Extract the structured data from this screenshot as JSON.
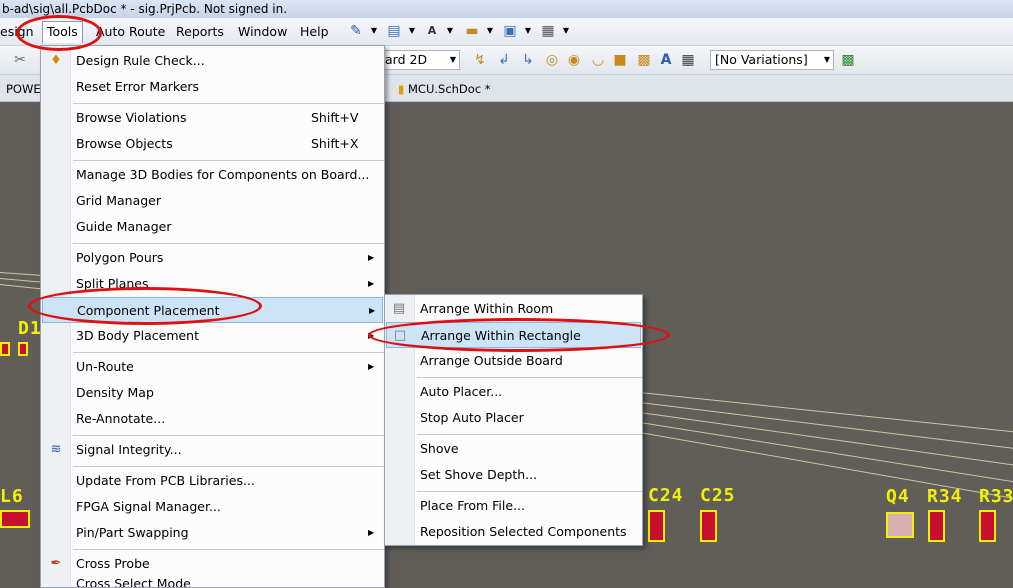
{
  "window": {
    "title": "b-ad\\sig\\all.PcbDoc * - sig.PrjPcb. Not signed in."
  },
  "menubar": {
    "items": [
      {
        "label": "esign"
      },
      {
        "label": "Tools"
      },
      {
        "label": "Auto Route"
      },
      {
        "label": "Reports"
      },
      {
        "label": "Window"
      },
      {
        "label": "Help"
      }
    ]
  },
  "toolbar": {
    "view_combo": "ard 2D",
    "variations_combo": "[No Variations]"
  },
  "tabs": {
    "left_tab": "POWE",
    "right_tab": "MCU.SchDoc *"
  },
  "tools_menu": {
    "items": [
      {
        "label": "Design Rule Check...",
        "shortcut": "",
        "icon": "drc-icon"
      },
      {
        "label": "Reset Error Markers",
        "shortcut": ""
      },
      {
        "label": "Browse Violations",
        "shortcut": "Shift+V"
      },
      {
        "label": "Browse Objects",
        "shortcut": "Shift+X"
      },
      {
        "label": "Manage 3D Bodies for Components on Board...",
        "shortcut": ""
      },
      {
        "label": "Grid Manager",
        "shortcut": ""
      },
      {
        "label": "Guide Manager",
        "shortcut": ""
      },
      {
        "label": "Polygon Pours",
        "shortcut": ""
      },
      {
        "label": "Split Planes",
        "shortcut": ""
      },
      {
        "label": "Component Placement",
        "shortcut": ""
      },
      {
        "label": "3D Body Placement",
        "shortcut": ""
      },
      {
        "label": "Un-Route",
        "shortcut": ""
      },
      {
        "label": "Density Map",
        "shortcut": ""
      },
      {
        "label": "Re-Annotate...",
        "shortcut": ""
      },
      {
        "label": "Signal Integrity...",
        "shortcut": "",
        "icon": "signal-integrity-icon"
      },
      {
        "label": "Update From PCB Libraries...",
        "shortcut": ""
      },
      {
        "label": "FPGA Signal Manager...",
        "shortcut": ""
      },
      {
        "label": "Pin/Part Swapping",
        "shortcut": ""
      },
      {
        "label": "Cross Probe",
        "shortcut": "",
        "icon": "cross-probe-icon"
      },
      {
        "label": "Cross Select Mode",
        "shortcut": ""
      }
    ]
  },
  "placement_submenu": {
    "items": [
      {
        "label": "Arrange Within Room"
      },
      {
        "label": "Arrange Within Rectangle"
      },
      {
        "label": "Arrange Outside Board"
      },
      {
        "label": "Auto Placer..."
      },
      {
        "label": "Stop Auto Placer"
      },
      {
        "label": "Shove"
      },
      {
        "label": "Set Shove Depth..."
      },
      {
        "label": "Place From File..."
      },
      {
        "label": "Reposition Selected Components"
      }
    ]
  },
  "pcb": {
    "designators": [
      "D1",
      "L6",
      "C24",
      "C25",
      "Q4",
      "R34",
      "R33"
    ]
  },
  "colors": {
    "workspace": "#615e59",
    "silkscreen": "#f2f200",
    "pad": "#c8102e",
    "highlight": "#cde3f7",
    "annotation": "#e01010"
  }
}
